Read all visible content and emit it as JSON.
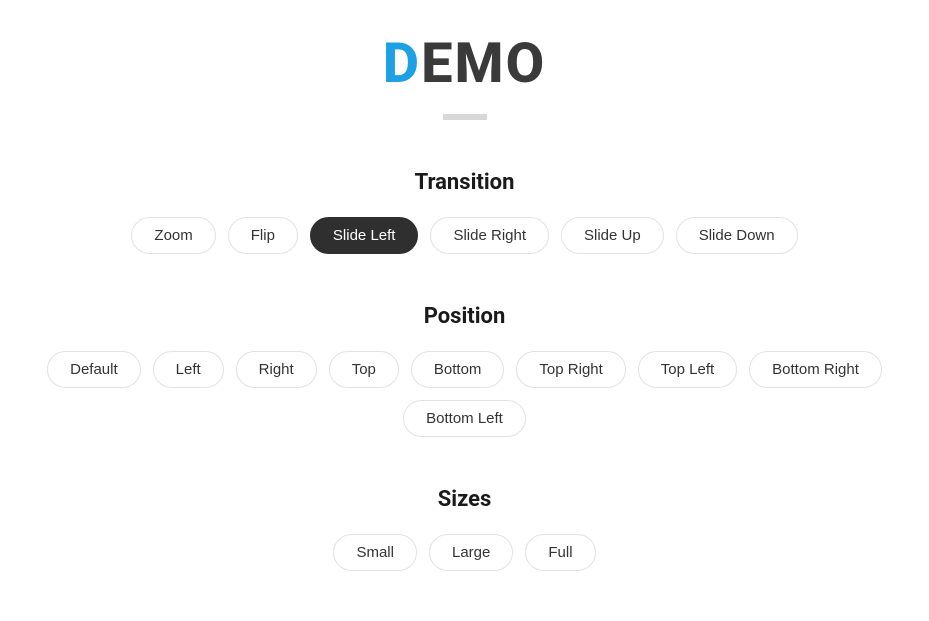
{
  "title": {
    "accent": "D",
    "rest": "EMO"
  },
  "sections": {
    "transition": {
      "title": "Transition",
      "items": [
        {
          "label": "Zoom",
          "active": false
        },
        {
          "label": "Flip",
          "active": false
        },
        {
          "label": "Slide Left",
          "active": true
        },
        {
          "label": "Slide Right",
          "active": false
        },
        {
          "label": "Slide Up",
          "active": false
        },
        {
          "label": "Slide Down",
          "active": false
        }
      ]
    },
    "position": {
      "title": "Position",
      "items": [
        {
          "label": "Default",
          "active": false
        },
        {
          "label": "Left",
          "active": false
        },
        {
          "label": "Right",
          "active": false
        },
        {
          "label": "Top",
          "active": false
        },
        {
          "label": "Bottom",
          "active": false
        },
        {
          "label": "Top Right",
          "active": false
        },
        {
          "label": "Top Left",
          "active": false
        },
        {
          "label": "Bottom Right",
          "active": false
        },
        {
          "label": "Bottom Left",
          "active": false
        }
      ]
    },
    "sizes": {
      "title": "Sizes",
      "items": [
        {
          "label": "Small",
          "active": false
        },
        {
          "label": "Large",
          "active": false
        },
        {
          "label": "Full",
          "active": false
        }
      ]
    }
  }
}
